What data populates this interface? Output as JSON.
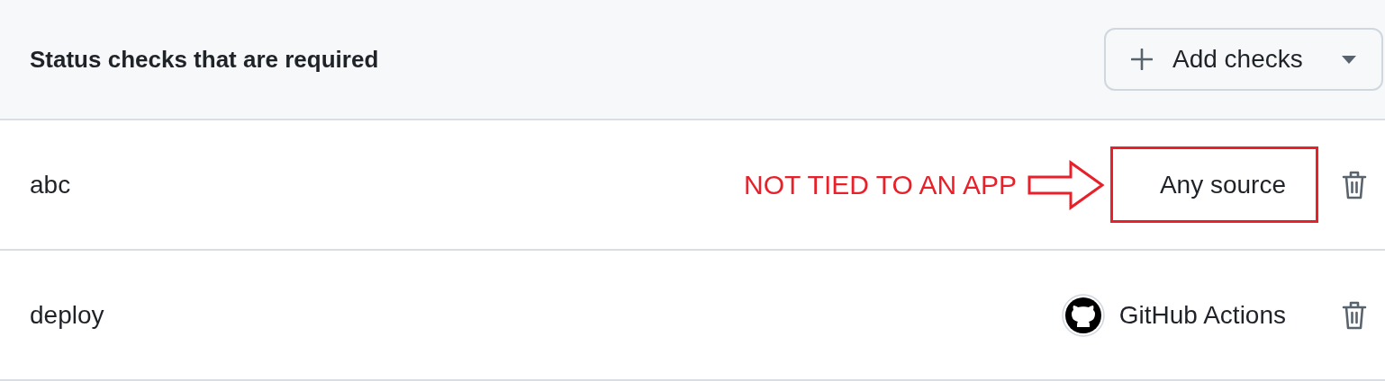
{
  "header": {
    "title": "Status checks that are required",
    "add_button": {
      "label": "Add checks"
    }
  },
  "checks": [
    {
      "name": "abc",
      "source": "Any source",
      "kind": "any",
      "highlighted": true,
      "annotation": "NOT TIED TO AN APP"
    },
    {
      "name": "deploy",
      "source": "GitHub Actions",
      "kind": "app",
      "highlighted": false
    }
  ]
}
